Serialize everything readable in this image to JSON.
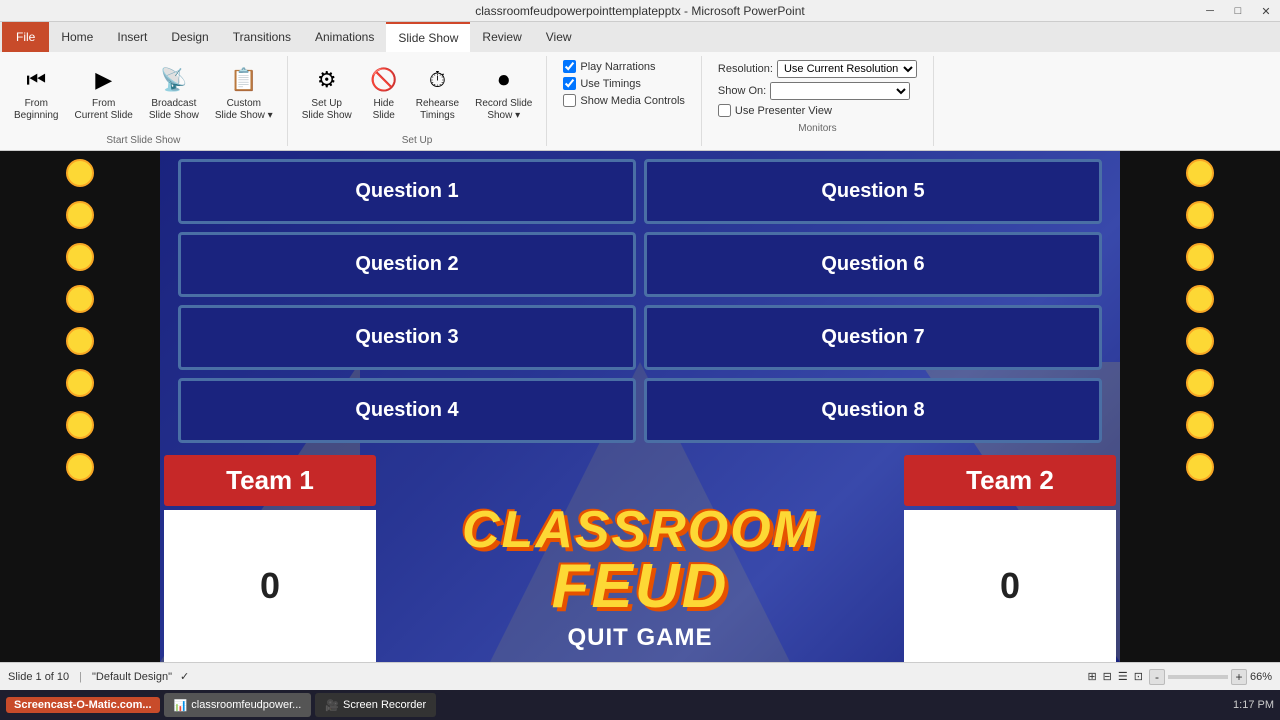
{
  "titlebar": {
    "title": "classroomfeudpowerpointtemplatepptx - Microsoft PowerPoint",
    "min": "🗕",
    "max": "🗖",
    "close": "✕"
  },
  "tabs": [
    {
      "label": "File",
      "type": "file"
    },
    {
      "label": "Home"
    },
    {
      "label": "Insert"
    },
    {
      "label": "Design"
    },
    {
      "label": "Transitions"
    },
    {
      "label": "Animations"
    },
    {
      "label": "Slide Show",
      "active": true
    },
    {
      "label": "Review"
    },
    {
      "label": "View"
    }
  ],
  "ribbon": {
    "groups": [
      {
        "label": "Start Slide Show",
        "buttons": [
          {
            "icon": "▶",
            "label": "From\nBeginning"
          },
          {
            "icon": "▷",
            "label": "From\nCurrent Slide"
          },
          {
            "icon": "📡",
            "label": "Broadcast\nSlide Show"
          },
          {
            "icon": "📋",
            "label": "Custom\nSlide Show",
            "dropdown": true
          }
        ]
      },
      {
        "label": "Set Up",
        "buttons": [
          {
            "icon": "⚙",
            "label": "Set Up\nSlide Show"
          },
          {
            "icon": "👁",
            "label": "Hide\nSlide"
          },
          {
            "icon": "⏱",
            "label": "Rehearse\nTimings"
          },
          {
            "icon": "🎬",
            "label": "Record Slide\nShow",
            "dropdown": true
          }
        ]
      },
      {
        "label": "",
        "checkboxes": [
          {
            "label": "Play Narrations",
            "checked": true
          },
          {
            "label": "Use Timings",
            "checked": true
          },
          {
            "label": "Show Media Controls",
            "checked": false
          }
        ]
      },
      {
        "label": "Monitors",
        "monitor_rows": [
          {
            "label": "Resolution:",
            "value": "Use Current Resolution"
          },
          {
            "label": "Show On:",
            "value": ""
          },
          {
            "label": "",
            "checkbox": "Use Presenter View",
            "checked": false
          }
        ]
      }
    ]
  },
  "questions": [
    {
      "label": "Question 1"
    },
    {
      "label": "Question 5"
    },
    {
      "label": "Question 2"
    },
    {
      "label": "Question 6"
    },
    {
      "label": "Question 3"
    },
    {
      "label": "Question 7"
    },
    {
      "label": "Question 4"
    },
    {
      "label": "Question 8"
    }
  ],
  "title_line1": "CLASSROOM",
  "title_line2": "FEUD",
  "team1": {
    "label": "Team 1",
    "score": "0"
  },
  "team2": {
    "label": "Team 2",
    "score": "0"
  },
  "quit_game": "QUIT GAME",
  "statusbar": {
    "slide_info": "Slide 1 of 10",
    "theme": "\"Default Design\"",
    "checkmark": "✓",
    "zoom": "66%"
  },
  "taskbar": {
    "brand": "Screencast-O-Matic.com...",
    "apps": [
      {
        "label": "classroomfeudpower...",
        "active": true
      },
      {
        "label": "Screen Recorder"
      }
    ],
    "time": "1:17 PM"
  }
}
